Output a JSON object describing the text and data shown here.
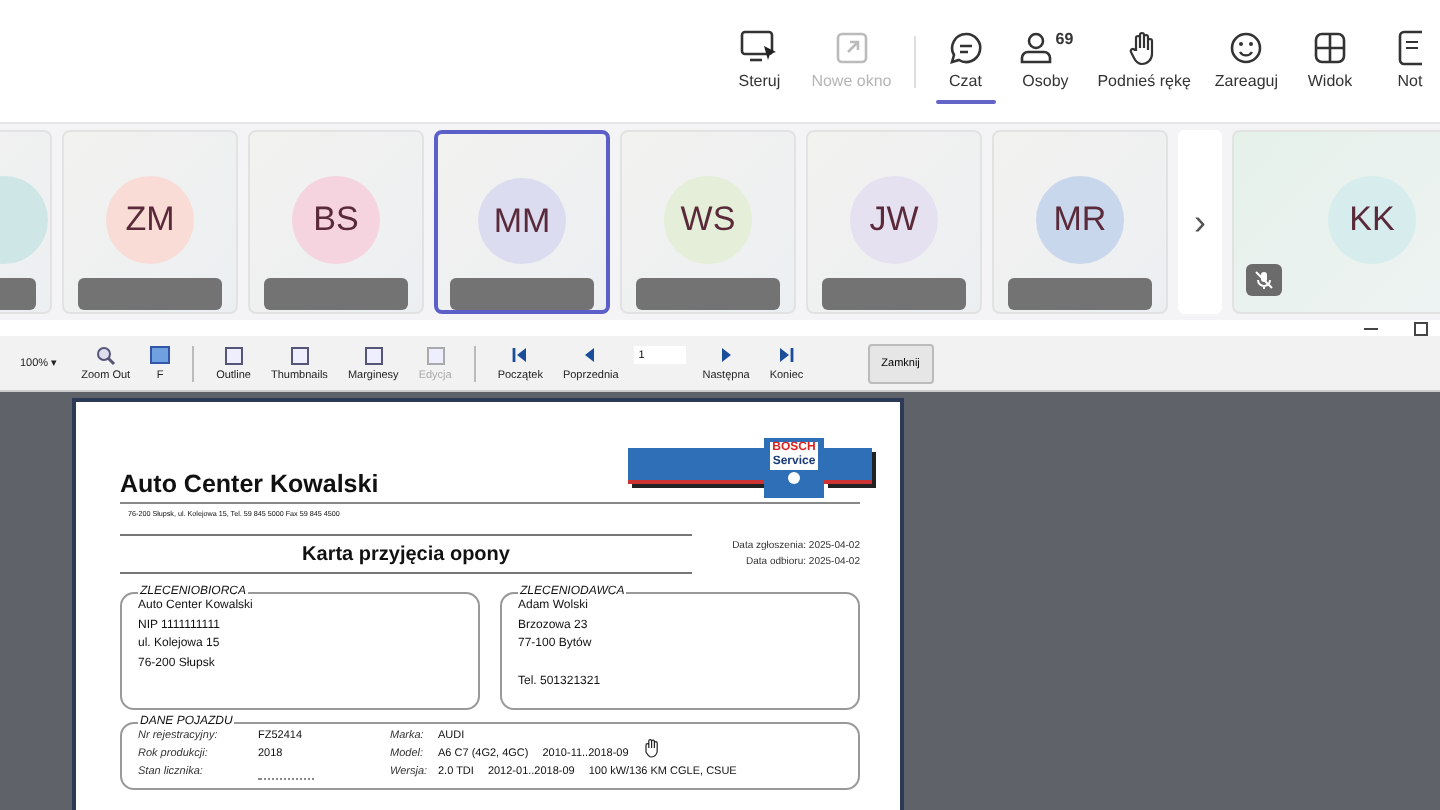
{
  "meeting_toolbar": [
    {
      "kind": "control",
      "label": "Steruj",
      "disabled": false,
      "selected": false
    },
    {
      "kind": "popout",
      "label": "Nowe okno",
      "disabled": true,
      "selected": false
    },
    {
      "kind": "chat",
      "label": "Czat",
      "disabled": false,
      "selected": true
    },
    {
      "kind": "people",
      "label": "Osoby",
      "count": "69",
      "disabled": false,
      "selected": false
    },
    {
      "kind": "hand",
      "label": "Podnieś rękę",
      "disabled": false,
      "selected": false
    },
    {
      "kind": "react",
      "label": "Zareaguj",
      "disabled": false,
      "selected": false
    },
    {
      "kind": "view",
      "label": "Widok",
      "disabled": false,
      "selected": false
    },
    {
      "kind": "notes",
      "label": "Not",
      "disabled": false,
      "selected": false
    }
  ],
  "participants": [
    {
      "color": "#cfe6e6",
      "selected": false
    },
    {
      "initials": "ZM",
      "color": "#f9dcd6",
      "selected": false
    },
    {
      "initials": "BS",
      "color": "#f5d3df",
      "selected": false
    },
    {
      "initials": "MM",
      "color": "#dcdcf0",
      "selected": true
    },
    {
      "initials": "WS",
      "color": "#e4eed8",
      "selected": false
    },
    {
      "initials": "JW",
      "color": "#e6e1f0",
      "selected": false
    },
    {
      "initials": "MR",
      "color": "#c9d7ec",
      "selected": false
    }
  ],
  "next_arrow": "›",
  "spotlight": {
    "initials": "KK",
    "color": "#d6eced",
    "muted": true
  },
  "viewer_toolbar": {
    "zoom": "100%",
    "zoom_caret": "▾",
    "items": [
      {
        "kind": "zoomout",
        "label": "Zoom Out",
        "disabled": false
      },
      {
        "kind": "f",
        "label": "F",
        "disabled": false
      },
      {
        "kind": "sep"
      },
      {
        "kind": "outline",
        "label": "Outline",
        "disabled": false
      },
      {
        "kind": "thumbs",
        "label": "Thumbnails",
        "disabled": false
      },
      {
        "kind": "margins",
        "label": "Marginesy",
        "disabled": false
      },
      {
        "kind": "edit",
        "label": "Edycja",
        "disabled": true
      },
      {
        "kind": "sep"
      },
      {
        "kind": "first",
        "label": "Początek",
        "disabled": false
      },
      {
        "kind": "prev",
        "label": "Poprzednia",
        "disabled": false
      },
      {
        "kind": "page",
        "value": "1"
      },
      {
        "kind": "next",
        "label": "Następna",
        "disabled": false
      },
      {
        "kind": "last",
        "label": "Koniec",
        "disabled": false
      }
    ],
    "close": "Zamknij"
  },
  "document": {
    "company": "Auto Center Kowalski",
    "address": "76-200 Słupsk, ul. Kolejowa 15, Tel. 59 845 5000 Fax 59 845 4500",
    "logo": [
      "BOSCH",
      "Service"
    ],
    "title": "Karta przyjęcia opony",
    "dates": [
      "Data zgłoszenia: 2025-04-02",
      "Data odbioru: 2025-04-02"
    ],
    "client": {
      "heading": "ZLECENIOBIORCA",
      "lines": [
        "Auto Center Kowalski",
        "NIP 1111111111",
        "ul. Kolejowa 15",
        "76-200 Słupsk"
      ]
    },
    "contractor": {
      "heading": "ZLECENIODAWCA",
      "lines": [
        "Adam Wolski",
        "Brzozowa 23",
        "77-100 Bytów"
      ],
      "phone": "Tel. 501321321"
    },
    "vehicle": {
      "heading": "DANE POJAZDU",
      "rows": [
        {
          "label": "Nr rejestracyjny:",
          "value": "FZ52414",
          "label2": "Marka:",
          "values2": [
            "AUDI"
          ]
        },
        {
          "label": "Rok produkcji:",
          "value": "2018",
          "label2": "Model:",
          "values2": [
            "A6 C7 (4G2, 4GC)",
            "2010-11..2018-09"
          ]
        },
        {
          "label": "Stan licznika:",
          "value": "",
          "label2": "Wersja:",
          "values2": [
            "2.0 TDI",
            "2012-01..2018-09",
            "100 kW/136 KM CGLE, CSUE"
          ]
        }
      ]
    }
  }
}
